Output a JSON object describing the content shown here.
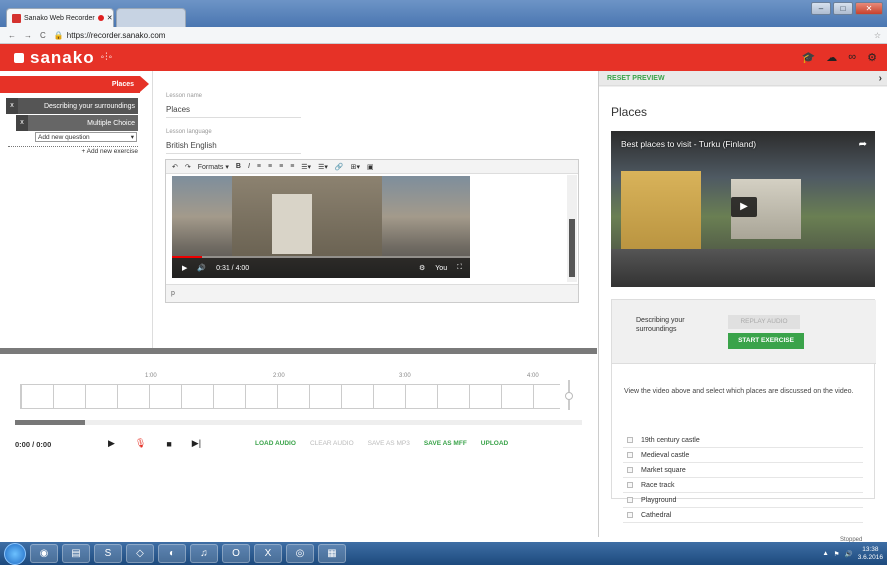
{
  "browser": {
    "tab_title": "Sanako Web Recorder",
    "url": "https://recorder.sanako.com",
    "win_min": "–",
    "win_max": "□",
    "win_close": "✕"
  },
  "app": {
    "logo": "sanako",
    "header_icons": [
      "graduation-cap-icon",
      "cloud-icon",
      "link-icon",
      "gear-icon"
    ]
  },
  "tree": {
    "lesson": "Places",
    "exercise": "Describing your surroundings",
    "question": "Multiple Choice",
    "add_question": "Add new question",
    "add_exercise": "+ Add new exercise",
    "remove_label": "x"
  },
  "editor": {
    "lesson_name_label": "Lesson name",
    "lesson_name": "Places",
    "lesson_language_label": "Lesson language",
    "lesson_language": "British English",
    "toolbar_formats": "Formats ▾",
    "toolbar_bold": "B",
    "toolbar_italic": "I",
    "video_time": "0:31 / 4:00",
    "status_path": "p"
  },
  "audio": {
    "time": "0:00 / 0:00",
    "ticks": [
      "1:00",
      "2:00",
      "3:00",
      "4:00"
    ],
    "load": "LOAD AUDIO",
    "clear": "CLEAR AUDIO",
    "save_mp3": "SAVE AS MP3",
    "save_mff": "SAVE AS MFF",
    "upload": "UPLOAD"
  },
  "preview": {
    "reset": "RESET PREVIEW",
    "title": "Places",
    "video_title": "Best places to visit - Turku (Finland)",
    "exercise_name": "Describing your surroundings",
    "replay": "REPLAY AUDIO",
    "start": "START EXERCISE",
    "instructions": "View the video above and select which places are discussed on the video.",
    "options": [
      "19th century castle",
      "Medieval castle",
      "Market square",
      "Race track",
      "Playground",
      "Cathedral"
    ]
  },
  "status": {
    "stopped": "Stopped",
    "clock_time": "13:38",
    "clock_date": "3.6.2016"
  }
}
